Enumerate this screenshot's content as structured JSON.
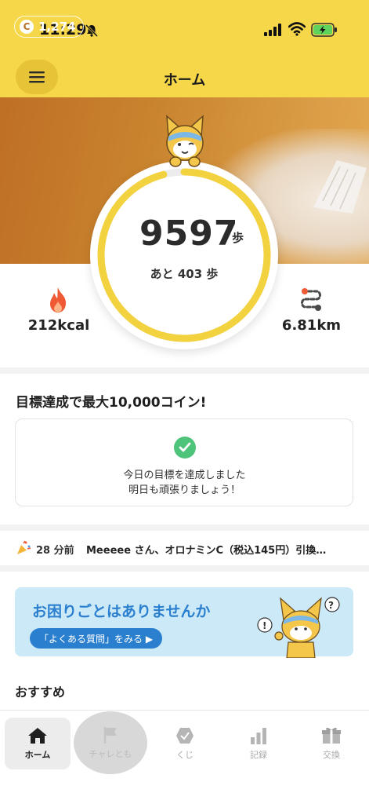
{
  "status_bar": {
    "time": "11:29"
  },
  "header": {
    "title": "ホーム",
    "menu_icon": "hamburger-icon"
  },
  "hero": {
    "coins": "1,274",
    "coin_symbol": "C"
  },
  "steps": {
    "count": "9597",
    "unit": "歩",
    "remaining": "あと 403 歩",
    "goal_progress": 0.96
  },
  "stats": {
    "calories": "212kcal",
    "distance": "6.81km"
  },
  "goal": {
    "title": "目標達成で最大10,000コイン!",
    "message_line1": "今日の目標を達成しました",
    "message_line2": "明日も頑張りましょう！"
  },
  "ticker": {
    "time": "28 分前",
    "text": "Meeeee さん、オロナミンC（税込145円）引換…"
  },
  "faq": {
    "title": "お困りごとはありませんか",
    "button": "「よくある質問」をみる ▶"
  },
  "recommend": {
    "title": "おすすめ"
  },
  "nav": {
    "home": "ホーム",
    "challenge": "チャレとも",
    "kuji": "くじ",
    "record": "記録",
    "exchange": "交換"
  },
  "colors": {
    "brand_yellow": "#f6d74a",
    "ring": "#f3d23f",
    "accent_blue": "#2b7fcf",
    "success_green": "#4ec37a"
  }
}
